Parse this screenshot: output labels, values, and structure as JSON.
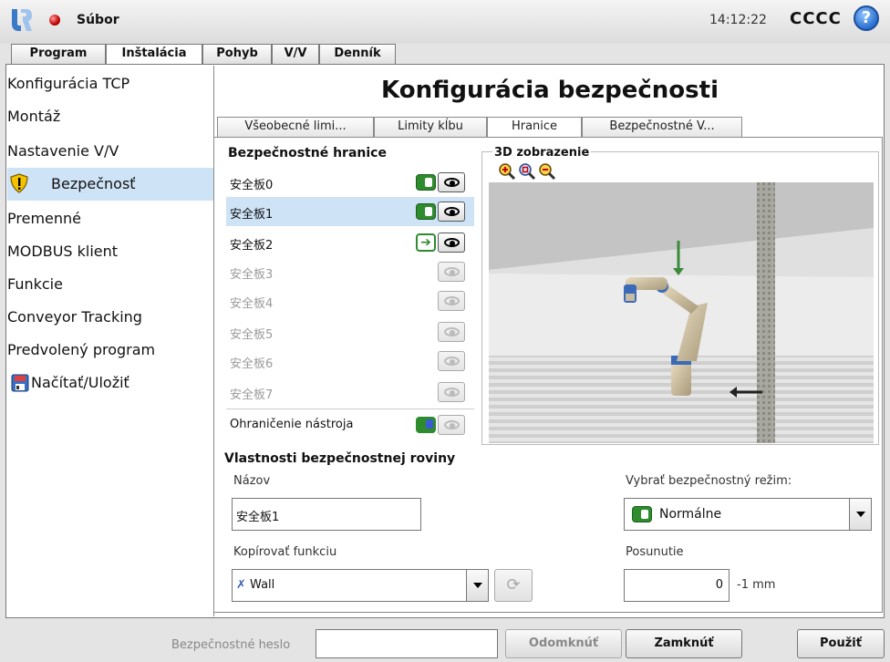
{
  "header": {
    "file_label": "Súbor",
    "clock": "14:12:22",
    "robot_name": "CCCC",
    "help_symbol": "?"
  },
  "main_tabs": [
    {
      "label": "Program"
    },
    {
      "label": "Inštalácia",
      "active": true
    },
    {
      "label": "Pohyb"
    },
    {
      "label": "V/V"
    },
    {
      "label": "Denník"
    }
  ],
  "sidebar": {
    "items": [
      {
        "label": "Konfigurácia TCP"
      },
      {
        "label": "Montáž"
      },
      {
        "label": "Nastavenie V/V"
      },
      {
        "label": "Bezpečnosť",
        "icon": "warning-shield-icon",
        "selected": true
      },
      {
        "label": "Premenné"
      },
      {
        "label": "MODBUS klient"
      },
      {
        "label": "Funkcie"
      },
      {
        "label": "Conveyor Tracking"
      },
      {
        "label": "Predvolený program"
      },
      {
        "label": "Načítať/Uložiť",
        "icon": "floppy-disk-icon"
      }
    ]
  },
  "page_title": "Konfigurácia bezpečnosti",
  "sub_tabs": [
    {
      "label": "Všeobecné limi..."
    },
    {
      "label": "Limity kĺbu"
    },
    {
      "label": "Hranice",
      "active": true
    },
    {
      "label": "Bezpečnostné V..."
    }
  ],
  "boundaries": {
    "title": "Bezpečnostné hranice",
    "items": [
      {
        "label": "安全板0",
        "state": "normal",
        "visible": true
      },
      {
        "label": "安全板1",
        "state": "normal",
        "visible": true,
        "selected": true
      },
      {
        "label": "安全板2",
        "state": "reduced-switch",
        "visible": true
      },
      {
        "label": "安全板3",
        "state": "disabled",
        "visible": false
      },
      {
        "label": "安全板4",
        "state": "disabled",
        "visible": false
      },
      {
        "label": "安全板5",
        "state": "disabled",
        "visible": false
      },
      {
        "label": "安全板6",
        "state": "disabled",
        "visible": false
      },
      {
        "label": "安全板7",
        "state": "disabled",
        "visible": false
      }
    ],
    "tool_limit_label": "Ohraničenie nástroja"
  },
  "view3d": {
    "title": "3D zobrazenie"
  },
  "properties": {
    "title": "Vlastnosti bezpečnostnej roviny",
    "name_label": "Názov",
    "name_value": "安全板1",
    "mode_label": "Vybrať bezpečnostný režim:",
    "mode_value": "Normálne",
    "copy_label": "Kopírovať funkciu",
    "copy_value": "Wall",
    "copy_icon": "✗",
    "shift_label": "Posunutie",
    "shift_value": "0",
    "shift_unit": "-1 mm"
  },
  "footer": {
    "password_label": "Bezpečnostné heslo",
    "unlock_label": "Odomknúť",
    "lock_label": "Zamknúť",
    "apply_label": "Použiť"
  },
  "colors": {
    "selection": "#cfe3f7",
    "normal_green": "#2e8b2e",
    "ui_blue": "#2a6fd0"
  }
}
